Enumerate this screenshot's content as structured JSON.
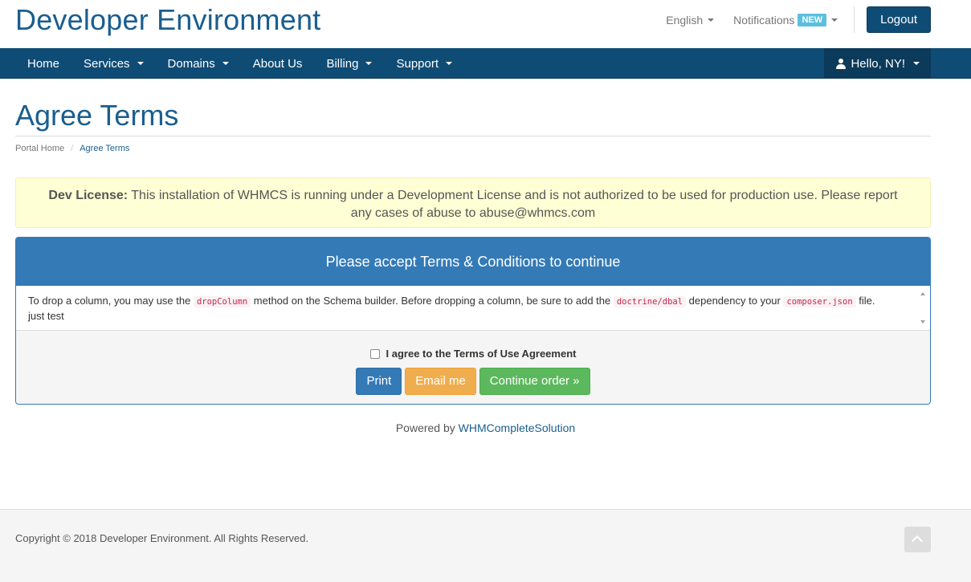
{
  "header": {
    "brand": "Developer Environment",
    "language": "English",
    "notifications": "Notifications",
    "notifications_badge": "NEW",
    "logout": "Logout"
  },
  "nav": {
    "items": [
      {
        "label": "Home"
      },
      {
        "label": "Services"
      },
      {
        "label": "Domains"
      },
      {
        "label": "About Us"
      },
      {
        "label": "Billing"
      },
      {
        "label": "Support"
      }
    ],
    "user": "Hello, NY!"
  },
  "page": {
    "title": "Agree Terms",
    "breadcrumb": [
      "Portal Home",
      "Agree Terms"
    ]
  },
  "alert": {
    "bold": "Dev License:",
    "text": " This installation of WHMCS is running under a Development License and is not authorized to be used for production use. Please report any cases of abuse to abuse@whmcs.com"
  },
  "panel": {
    "heading": "Please accept Terms & Conditions to continue",
    "terms": {
      "t1": "To drop a column, you may use the ",
      "c1": "dropColumn",
      "t2": " method on the Schema builder. Before dropping a column, be sure to add the ",
      "c2": "doctrine/dbal",
      "t3": " dependency to your ",
      "c3": "composer.json",
      "t4": " file.",
      "line2": "just test"
    },
    "agree_label": "I agree to the Terms of Use Agreement",
    "buttons": {
      "print": "Print",
      "email": "Email me",
      "continue": "Continue order »"
    }
  },
  "powered": {
    "prefix": "Powered by ",
    "link": "WHMCompleteSolution"
  },
  "footer": {
    "copyright": "Copyright © 2018 Developer Environment. All Rights Reserved."
  },
  "colors": {
    "brand": "#1a5e8f",
    "navbar": "#0f4c75",
    "panel_primary": "#337ab7",
    "warning": "#f0ad4e",
    "success": "#5cb85c",
    "alert_bg": "#ffffd5"
  }
}
